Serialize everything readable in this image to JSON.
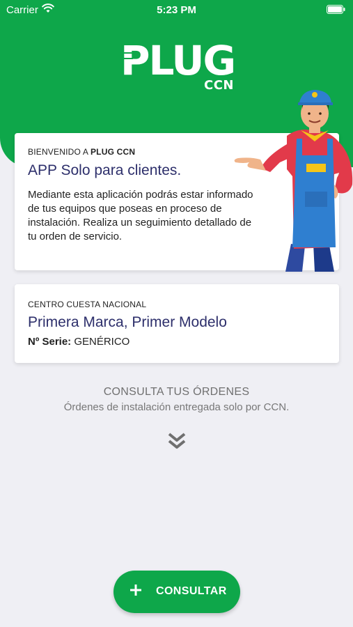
{
  "status_bar": {
    "carrier": "Carrier",
    "time": "5:23 PM"
  },
  "logo": {
    "word": "PLUG",
    "sub": "CCN"
  },
  "welcome_card": {
    "label_prefix": "BIENVENIDO A ",
    "label_brand": "PLUG CCN",
    "title": "APP Solo para clientes.",
    "body": "Mediante esta aplicación podrás estar informado de tus equipos que poseas en proceso de instalación. Realiza un seguimiento detallado de tu orden de servicio."
  },
  "product_card": {
    "label": "CENTRO CUESTA NACIONAL",
    "title": "Primera Marca, Primer Modelo",
    "serial_label": "Nº Serie:",
    "serial_value": "GENÉRICO"
  },
  "consulta": {
    "title": "CONSULTA TUS ÓRDENES",
    "subtitle": "Órdenes de instalación entregada solo por CCN."
  },
  "fab": {
    "label": "CONSULTAR",
    "icon": "plus-icon"
  },
  "colors": {
    "brand_green": "#0ea74a",
    "title_navy": "#2d2f6b"
  }
}
